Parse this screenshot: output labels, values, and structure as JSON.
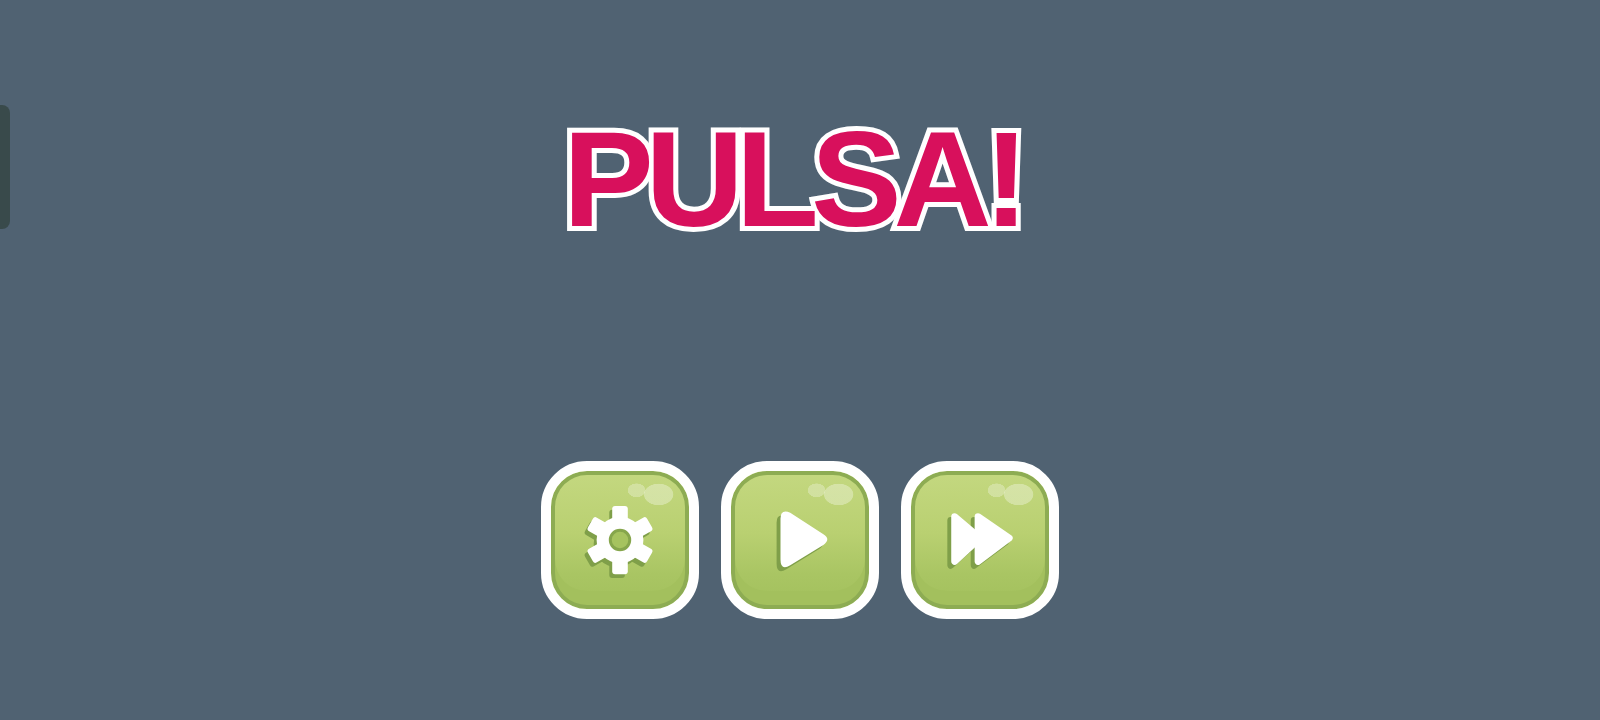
{
  "title": "PULSA!",
  "buttons": [
    {
      "kind": "settings"
    },
    {
      "kind": "play"
    },
    {
      "kind": "fast_forward"
    }
  ]
}
